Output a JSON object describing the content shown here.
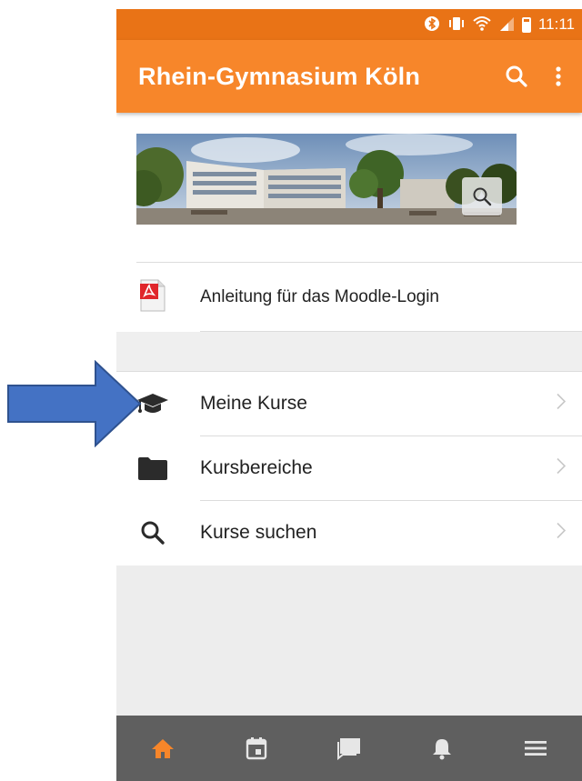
{
  "status_bar": {
    "time": "11:11",
    "icons": [
      "bluetooth-icon",
      "vibrate-icon",
      "wifi-icon",
      "signal-icon",
      "battery-icon"
    ]
  },
  "app_bar": {
    "title": "Rhein-Gymnasium Köln",
    "actions": [
      "search-icon",
      "more-vert-icon"
    ]
  },
  "banner": {
    "zoom_icon": "magnify-icon"
  },
  "resource": {
    "icon": "pdf-icon",
    "label": "Anleitung für das Moodle-Login"
  },
  "menu": {
    "items": [
      {
        "icon": "graduation-cap-icon",
        "label": "Meine Kurse"
      },
      {
        "icon": "folder-icon",
        "label": "Kursbereiche"
      },
      {
        "icon": "search-icon",
        "label": "Kurse suchen"
      }
    ]
  },
  "bottom_nav": {
    "items": [
      "home-icon",
      "calendar-icon",
      "messages-icon",
      "notifications-icon",
      "menu-icon"
    ],
    "active_index": 0
  },
  "colors": {
    "app_bar": "#f7862a",
    "status_bar": "#e97316",
    "bottom_nav": "#5f5f5f",
    "active_nav": "#f7862a",
    "arrow": "#4472c4"
  }
}
